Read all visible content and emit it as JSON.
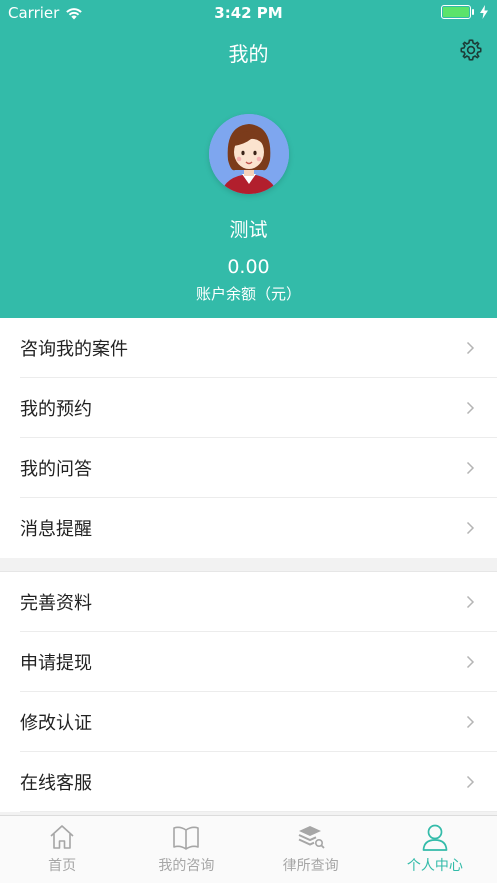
{
  "status_bar": {
    "carrier": "Carrier",
    "time": "3:42 PM"
  },
  "header": {
    "title": "我的",
    "username": "测试",
    "balance": "0.00",
    "balance_label": "账户余额（元）"
  },
  "menu_group_1": [
    {
      "label": "咨询我的案件"
    },
    {
      "label": "我的预约"
    },
    {
      "label": "我的问答"
    },
    {
      "label": "消息提醒"
    }
  ],
  "menu_group_2": [
    {
      "label": "完善资料"
    },
    {
      "label": "申请提现"
    },
    {
      "label": "修改认证"
    },
    {
      "label": "在线客服"
    }
  ],
  "tabbar": {
    "tabs": [
      {
        "label": "首页",
        "icon": "home-icon"
      },
      {
        "label": "我的咨询",
        "icon": "book-icon"
      },
      {
        "label": "律所查询",
        "icon": "layers-search-icon"
      },
      {
        "label": "个人中心",
        "icon": "person-icon",
        "active": true
      }
    ]
  },
  "colors": {
    "accent": "#33bba9",
    "inactive": "#a6a6a6"
  }
}
